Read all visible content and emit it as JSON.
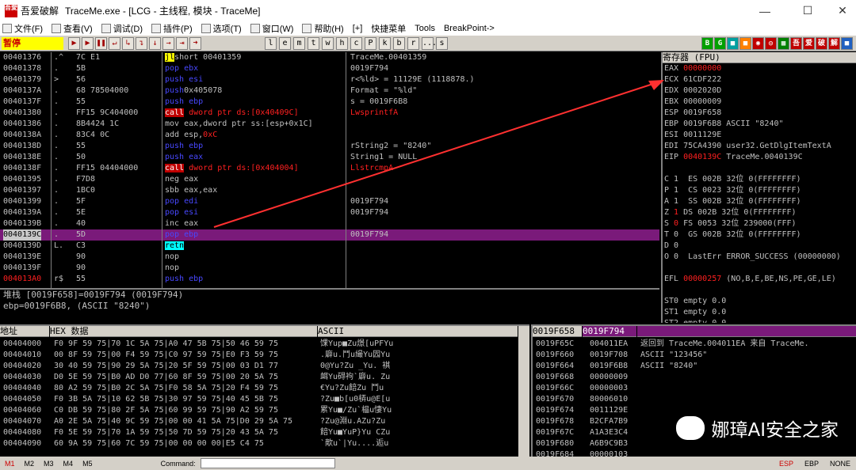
{
  "window": {
    "title_cn": "吾爱破解",
    "title": "TraceMe.exe - [LCG - 主线程, 模块 - TraceMe]",
    "logo_text": "吾愛"
  },
  "menu": [
    {
      "label": "文件(F)"
    },
    {
      "label": "查看(V)"
    },
    {
      "label": "调试(D)"
    },
    {
      "label": "插件(P)"
    },
    {
      "label": "选项(T)"
    },
    {
      "label": "窗口(W)"
    },
    {
      "label": "帮助(H)"
    },
    {
      "label": "[+]"
    },
    {
      "label": "快捷菜单"
    },
    {
      "label": "Tools"
    },
    {
      "label": "BreakPoint->"
    }
  ],
  "toolbar": {
    "state": "暂停",
    "letters": [
      "l",
      "e",
      "m",
      "t",
      "w",
      "h",
      "c",
      "P",
      "k",
      "b",
      "r",
      "...",
      "s"
    ],
    "right_icons": [
      {
        "t": "B",
        "c": "#00a000"
      },
      {
        "t": "G",
        "c": "#00a000"
      },
      {
        "t": "■",
        "c": "#00a0a0"
      },
      {
        "t": "■",
        "c": "#ff8000"
      },
      {
        "t": "◉",
        "c": "#c00000"
      },
      {
        "t": "◎",
        "c": "#c00000"
      },
      {
        "t": "▦",
        "c": "#008000"
      },
      {
        "t": "吾",
        "c": "#c00000"
      },
      {
        "t": "爱",
        "c": "#c00000"
      },
      {
        "t": "破",
        "c": "#c00000"
      },
      {
        "t": "解",
        "c": "#c00000"
      },
      {
        "t": "■",
        "c": "#2060c0"
      }
    ]
  },
  "disasm": [
    {
      "addr": "00401376",
      "mark": ".^",
      "hex": "7C E1",
      "asm": [
        [
          "kw-yel",
          "jl"
        ],
        [
          "",
          "short 00401359"
        ]
      ],
      "cmt": "TraceMe.00401359"
    },
    {
      "addr": "00401378",
      "mark": ".",
      "hex": "5B",
      "asm": [
        [
          "kw-pop",
          "pop ebx"
        ]
      ],
      "cmt": "0019F794"
    },
    {
      "addr": "00401379",
      "mark": ">",
      "hex": "56",
      "asm": [
        [
          "kw-push",
          "push esi"
        ]
      ],
      "cmt": "r<%ld> = 11129E (1118878.)"
    },
    {
      "addr": "0040137A",
      "mark": ".",
      "hex": "68 78504000",
      "asm": [
        [
          "kw-push",
          "push"
        ],
        [
          "",
          "0x405078"
        ]
      ],
      "cmt": "Format = \"%ld\""
    },
    {
      "addr": "0040137F",
      "mark": ".",
      "hex": "55",
      "asm": [
        [
          "kw-push",
          "push ebp"
        ]
      ],
      "cmt": "s = 0019F6B8"
    },
    {
      "addr": "00401380",
      "mark": ".",
      "hex": "FF15 9C404000",
      "asm": [
        [
          "kw-call",
          "call"
        ],
        [
          "red",
          " dword ptr ds:[0x40409C]"
        ]
      ],
      "cmt": "LwsprintfA",
      "cmtcls": "red"
    },
    {
      "addr": "00401386",
      "mark": ".",
      "hex": "8B4424 1C",
      "asm": [
        [
          "",
          "mov eax,dword ptr ss:[esp+0x1C]"
        ]
      ],
      "cmt": ""
    },
    {
      "addr": "0040138A",
      "mark": ".",
      "hex": "83C4 0C",
      "asm": [
        [
          "",
          "add esp,"
        ],
        [
          "red",
          "0xC"
        ]
      ],
      "cmt": ""
    },
    {
      "addr": "0040138D",
      "mark": ".",
      "hex": "55",
      "asm": [
        [
          "kw-push",
          "push ebp"
        ]
      ],
      "cmt": "rString2 = \"8240\""
    },
    {
      "addr": "0040138E",
      "mark": ".",
      "hex": "50",
      "asm": [
        [
          "kw-push",
          "push eax"
        ]
      ],
      "cmt": "String1 = NULL"
    },
    {
      "addr": "0040138F",
      "mark": ".",
      "hex": "FF15 04404000",
      "asm": [
        [
          "kw-call",
          "call"
        ],
        [
          "red",
          " dword ptr ds:[0x404004]"
        ]
      ],
      "cmt": "LlstrcmpA",
      "cmtcls": "red"
    },
    {
      "addr": "00401395",
      "mark": ".",
      "hex": "F7D8",
      "asm": [
        [
          "",
          "neg eax"
        ]
      ],
      "cmt": ""
    },
    {
      "addr": "00401397",
      "mark": ".",
      "hex": "1BC0",
      "asm": [
        [
          "",
          "sbb eax,eax"
        ]
      ],
      "cmt": ""
    },
    {
      "addr": "00401399",
      "mark": ".",
      "hex": "5F",
      "asm": [
        [
          "kw-pop",
          "pop edi"
        ]
      ],
      "cmt": "0019F794"
    },
    {
      "addr": "0040139A",
      "mark": ".",
      "hex": "5E",
      "asm": [
        [
          "kw-pop",
          "pop esi"
        ]
      ],
      "cmt": "0019F794"
    },
    {
      "addr": "0040139B",
      "mark": ".",
      "hex": "40",
      "asm": [
        [
          "",
          "inc eax"
        ]
      ],
      "cmt": ""
    },
    {
      "addr": "0040139C",
      "mark": ".",
      "hex": "5D",
      "asm": [
        [
          "kw-pop",
          "pop ebp"
        ]
      ],
      "cmt": "0019F794",
      "sel": true
    },
    {
      "addr": "0040139D",
      "mark": "L.",
      "hex": "C3",
      "asm": [
        [
          "kw-retn",
          "retn"
        ]
      ],
      "cmt": ""
    },
    {
      "addr": "0040139E",
      "mark": "",
      "hex": "90",
      "asm": [
        [
          "",
          "nop"
        ]
      ],
      "cmt": ""
    },
    {
      "addr": "0040139F",
      "mark": "",
      "hex": "90",
      "asm": [
        [
          "",
          "nop"
        ]
      ],
      "cmt": ""
    },
    {
      "addr": "004013A0",
      "mark": "r$",
      "hex": "55",
      "asm": [
        [
          "kw-push",
          "push ebp"
        ]
      ],
      "cmt": "",
      "addrcls": "red"
    }
  ],
  "info": {
    "line1": "堆栈 [0019F658]=0019F794 (0019F794)",
    "line2": "ebp=0019F6B8, (ASCII \"8240\")"
  },
  "regs": {
    "header": "寄存器 (FPU)",
    "lines": [
      [
        [
          "",
          "EAX "
        ],
        [
          "red",
          "00000000"
        ]
      ],
      [
        [
          "",
          "ECX 61CDF222"
        ]
      ],
      [
        [
          "",
          "EDX 0002020D"
        ]
      ],
      [
        [
          "",
          "EBX 00000009"
        ]
      ],
      [
        [
          "",
          "ESP 0019F658"
        ]
      ],
      [
        [
          "",
          "EBP 0019F6B8 ASCII \"8240\""
        ]
      ],
      [
        [
          "",
          "ESI 0011129E"
        ]
      ],
      [
        [
          "",
          "EDI 75CA4390 user32.GetDlgItemTextA"
        ]
      ],
      [
        [
          "",
          "EIP "
        ],
        [
          "red",
          "0040139C"
        ],
        [
          "",
          " TraceMe.0040139C"
        ]
      ],
      [
        [
          "",
          ""
        ]
      ],
      [
        [
          "",
          "C 1  ES 002B 32位 0(FFFFFFFF)"
        ]
      ],
      [
        [
          "",
          "P 1  CS 0023 32位 0(FFFFFFFF)"
        ]
      ],
      [
        [
          "",
          "A 1  SS 002B 32位 0(FFFFFFFF)"
        ]
      ],
      [
        [
          "",
          "Z "
        ],
        [
          "red",
          "1"
        ],
        [
          "",
          " DS 002B 32位 0(FFFFFFFF)"
        ]
      ],
      [
        [
          "",
          "S "
        ],
        [
          "red",
          "0"
        ],
        [
          "",
          " FS 0053 32位 239000(FFF)"
        ]
      ],
      [
        [
          "",
          "T 0  GS 002B 32位 0(FFFFFFFF)"
        ]
      ],
      [
        [
          "",
          "D 0"
        ]
      ],
      [
        [
          "",
          "O 0  LastErr ERROR_SUCCESS (00000000)"
        ]
      ],
      [
        [
          "",
          ""
        ]
      ],
      [
        [
          "",
          "EFL "
        ],
        [
          "red",
          "00000257"
        ],
        [
          "",
          " (NO,B,E,BE,NS,PE,GE,LE)"
        ]
      ],
      [
        [
          "",
          ""
        ]
      ],
      [
        [
          "",
          "ST0 empty 0.0"
        ]
      ],
      [
        [
          "",
          "ST1 empty 0.0"
        ]
      ],
      [
        [
          "",
          "ST2 empty 0.0"
        ]
      ]
    ]
  },
  "dump": {
    "h_addr": "地址",
    "h_hex": "HEX 数据",
    "h_ascii": "ASCII",
    "rows": [
      [
        "00404000",
        "F0 9F 59 75|70 1C 5A 75|A0 47 5B 75|50 46 59 75",
        "馃Yup■Zu燝[uPFYu"
      ],
      [
        "00404010",
        "00 8F 59 75|00 F4 59 75|C0 97 59 75|E0 F3 59 75",
        ".廦u.鬥u繓Yu囥Yu"
      ],
      [
        "00404020",
        "30 40 59 75|90 29 5A 75|20 5F 59 75|00 03 D1 77",
        "0@Yu?Zu _Yu. 褀"
      ],
      [
        "00404030",
        "D0 5E 59 75|B0 AD D0 77|60 8F 59 75|00 20 5A 75",
        "衈Yu碍袧`廦u. Zu"
      ],
      [
        "00404040",
        "80 A2 59 75|B0 2C 5A 75|F0 58 5A 75|20 F4 59 75",
        "€Yu?Zu餢Zu 鬥u"
      ],
      [
        "00404050",
        "F0 3B 5A 75|10 62 5B 75|30 97 59 75|40 45 5B 75",
        "?Zu■b[u0梇u@E[u"
      ],
      [
        "00404060",
        "C0 DB 59 75|80 2F 5A 75|60 99 59 75|90 A2 59 75",
        "累Yu■/Zu`橸u悽Yu"
      ],
      [
        "00404070",
        "A0 2E 5A 75|40 9C 59 75|00 00 41 5A 75|D0 29 5A 75",
        "?Zu@淵u.AZu?Zu"
      ],
      [
        "00404080",
        "F0 5E 59 75|70 1A 59 75|50 7D 59 75|20 43 5A 75",
        "餢Yu■YuP}Yu CZu"
      ],
      [
        "00404090",
        "60 9A 59 75|60 7C 59 75|00 00 00 00|E5 C4 75",
        "`歒u`|Yu....逅u"
      ]
    ]
  },
  "stack": {
    "h_addr": "0019F658",
    "h_val": "0019F794",
    "rows": [
      [
        "0019F65C",
        "004011EA",
        "返回到 TraceMe.004011EA 来自 TraceMe."
      ],
      [
        "0019F660",
        "0019F708",
        "ASCII \"123456\""
      ],
      [
        "0019F664",
        "0019F6B8",
        "ASCII \"8240\""
      ],
      [
        "0019F668",
        "00000009",
        ""
      ],
      [
        "0019F66C",
        "00000003",
        ""
      ],
      [
        "0019F670",
        "80006010",
        ""
      ],
      [
        "0019F674",
        "0011129E",
        ""
      ],
      [
        "0019F678",
        "B2CFA7B9",
        ""
      ],
      [
        "0019F67C",
        "A1A3E3C4",
        ""
      ],
      [
        "0019F680",
        "A6B9C9B3",
        ""
      ],
      [
        "0019F684",
        "00000103",
        ""
      ]
    ]
  },
  "statusbar": {
    "m": [
      "M1",
      "M2",
      "M3",
      "M4",
      "M5"
    ],
    "cmd_label": "Command:",
    "right": [
      "ESP",
      "EBP",
      "NONE"
    ]
  },
  "watermark": "娜璋AI安全之家",
  "colors": {
    "accent_red": "#ff2020",
    "selection": "#7a1a7a",
    "call_bg": "#c00000",
    "state_bg": "#ffff00"
  }
}
